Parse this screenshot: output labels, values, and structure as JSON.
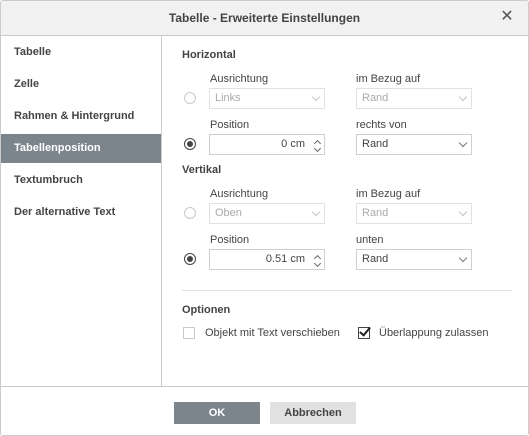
{
  "dialog": {
    "title": "Tabelle - Erweiterte Einstellungen",
    "close_icon": "close-icon"
  },
  "sidebar": {
    "items": [
      {
        "label": "Tabelle",
        "active": false
      },
      {
        "label": "Zelle",
        "active": false
      },
      {
        "label": "Rahmen & Hintergrund",
        "active": false
      },
      {
        "label": "Tabellenposition",
        "active": true
      },
      {
        "label": "Textumbruch",
        "active": false
      },
      {
        "label": "Der alternative Text",
        "active": false
      }
    ]
  },
  "horizontal": {
    "title": "Horizontal",
    "alignment_label": "Ausrichtung",
    "alignment_value": "Links",
    "relative_label_1": "im Bezug auf",
    "relative_value_1": "Rand",
    "position_label": "Position",
    "position_value": "0 cm",
    "relative_label_2": "rechts von",
    "relative_value_2": "Rand",
    "mode": "position"
  },
  "vertical": {
    "title": "Vertikal",
    "alignment_label": "Ausrichtung",
    "alignment_value": "Oben",
    "relative_label_1": "im Bezug auf",
    "relative_value_1": "Rand",
    "position_label": "Position",
    "position_value": "0.51 cm",
    "relative_label_2": "unten",
    "relative_value_2": "Rand",
    "mode": "position"
  },
  "options": {
    "title": "Optionen",
    "move_with_text_label": "Objekt mit Text verschieben",
    "move_with_text_checked": false,
    "allow_overlap_label": "Überlappung zulassen",
    "allow_overlap_checked": true
  },
  "footer": {
    "ok_label": "OK",
    "cancel_label": "Abbrechen"
  },
  "colors": {
    "accent": "#7d858c",
    "secondary_button": "#e1e1e1"
  }
}
